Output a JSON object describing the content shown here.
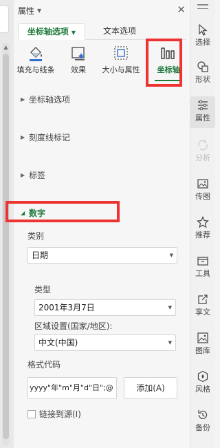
{
  "panel": {
    "title": "属性",
    "tabs": [
      {
        "label": "坐标轴选项",
        "active": true
      },
      {
        "label": "文本选项",
        "active": false
      }
    ],
    "subtabs": [
      {
        "label": "填充与线条",
        "icon": "fill-bucket-icon"
      },
      {
        "label": "效果",
        "icon": "effects-icon"
      },
      {
        "label": "大小与属性",
        "icon": "size-properties-icon"
      },
      {
        "label": "坐标轴",
        "icon": "axis-bars-icon",
        "active": true
      }
    ],
    "sections": [
      {
        "label": "坐标轴选项",
        "expanded": false
      },
      {
        "label": "刻度线标记",
        "expanded": false
      },
      {
        "label": "标签",
        "expanded": false
      },
      {
        "label": "数字",
        "expanded": true
      }
    ],
    "number": {
      "category_label": "类别",
      "category_value": "日期",
      "type_label": "类型",
      "type_value": "2001年3月7日",
      "locale_label": "区域设置(国家/地区):",
      "locale_value": "中文(中国)",
      "format_code_label": "格式代码",
      "format_code_value": "yyyy\"年\"m\"月\"d\"日\";@",
      "add_button_label": "添加(A)",
      "link_to_source_label": "链接到源(I)"
    }
  },
  "rail": {
    "items": [
      {
        "label": "选择",
        "icon": "cursor-icon"
      },
      {
        "label": "形状",
        "icon": "shapes-icon"
      },
      {
        "label": "属性",
        "icon": "sliders-icon",
        "active": true
      },
      {
        "label": "分析",
        "icon": "analysis-icon",
        "disabled": true
      },
      {
        "label": "传图",
        "icon": "upload-image-icon"
      },
      {
        "label": "推荐",
        "icon": "star-icon"
      },
      {
        "label": "工具",
        "icon": "toolbox-icon"
      },
      {
        "label": "享文",
        "icon": "share-icon"
      },
      {
        "label": "图库",
        "icon": "gallery-icon"
      },
      {
        "label": "风格",
        "icon": "style-icon"
      },
      {
        "label": "备份",
        "icon": "backup-icon"
      }
    ]
  },
  "colors": {
    "accent": "#1f7a3c",
    "highlight": "#ee3333"
  }
}
